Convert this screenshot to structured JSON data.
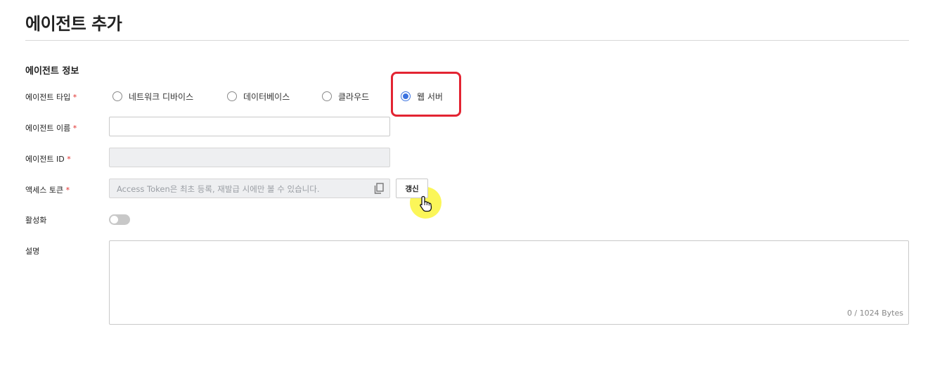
{
  "page": {
    "title": "에이전트 추가"
  },
  "section": {
    "title": "에이전트 정보"
  },
  "fields": {
    "type_label": "에이전트 타입",
    "name_label": "에이전트 이름",
    "id_label": "에이전트 ID",
    "token_label": "액세스 토큰",
    "active_label": "활성화",
    "description_label": "설명",
    "required_mark": "*"
  },
  "agent_types": {
    "selected": "웹 서버",
    "options": [
      {
        "label": "네트워크 디바이스",
        "checked": false
      },
      {
        "label": "데이터베이스",
        "checked": false
      },
      {
        "label": "클라우드",
        "checked": false
      },
      {
        "label": "웹 서버",
        "checked": true
      }
    ]
  },
  "inputs": {
    "name_value": "",
    "id_value": "",
    "token_placeholder": "Access Token은 최초 등록, 재발급 시에만 볼 수 있습니다.",
    "description_value": ""
  },
  "buttons": {
    "renew_label": "갱신"
  },
  "toggle": {
    "active": false
  },
  "counter": {
    "text": "0 / 1024 Bytes"
  },
  "icons": {
    "copy": "copy-icon",
    "cursor": "hand-pointer-icon"
  },
  "colors": {
    "accent": "#3b73e0",
    "required": "#e0302e",
    "highlight": "#e32432",
    "cursor_halo": "#faf53c"
  }
}
